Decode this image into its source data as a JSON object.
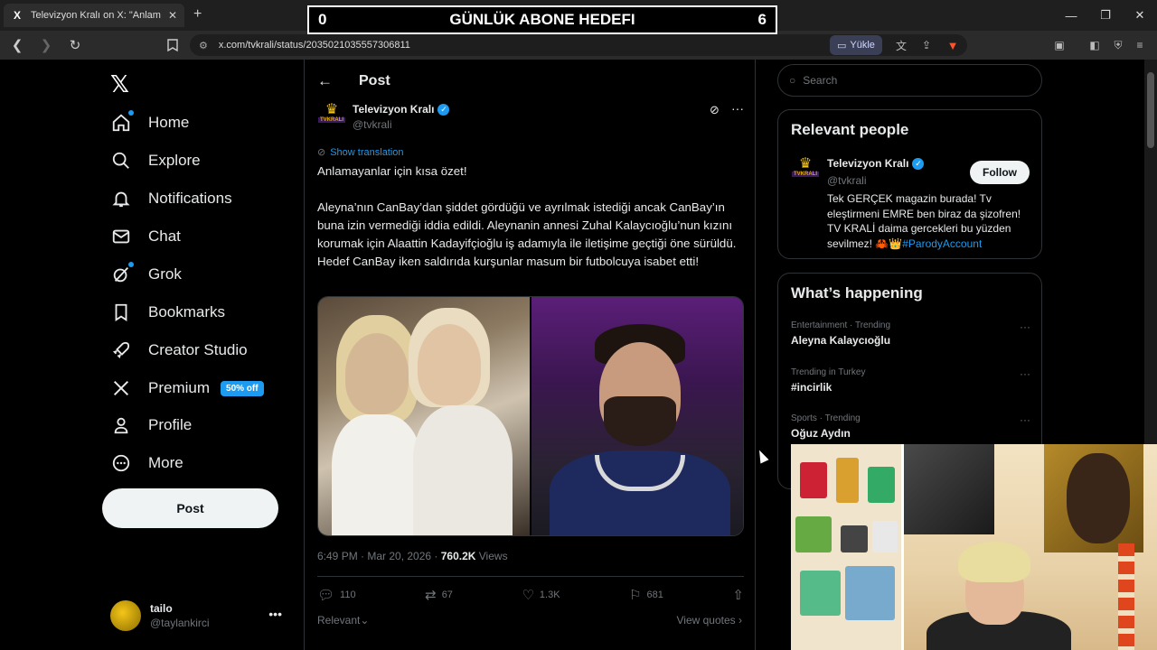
{
  "browser": {
    "tab_title": "Televizyon Kralı on X: \"Anlamaya",
    "tab_favicon": "X",
    "url": "x.com/tvkrali/status/2035021035557306811",
    "yukle_label": "Yükle"
  },
  "overlay_banner": {
    "left_count": "0",
    "title": "GÜNLÜK ABONE HEDEFI",
    "right_count": "6"
  },
  "nav": {
    "items": [
      {
        "label": "Home",
        "icon": "home-icon",
        "dot": true
      },
      {
        "label": "Explore",
        "icon": "search-icon",
        "dot": false
      },
      {
        "label": "Notifications",
        "icon": "bell-icon",
        "dot": false
      },
      {
        "label": "Chat",
        "icon": "mail-icon",
        "dot": false
      },
      {
        "label": "Grok",
        "icon": "grok-icon",
        "dot": true
      },
      {
        "label": "Bookmarks",
        "icon": "bookmark-icon",
        "dot": false
      },
      {
        "label": "Creator Studio",
        "icon": "rocket-icon",
        "dot": false
      },
      {
        "label": "Premium",
        "icon": "x-icon",
        "dot": false
      },
      {
        "label": "Profile",
        "icon": "person-icon",
        "dot": false
      },
      {
        "label": "More",
        "icon": "more-circle-icon",
        "dot": false
      }
    ],
    "premium_badge": "50% off",
    "post_button": "Post"
  },
  "account": {
    "name": "tailo",
    "handle": "@taylankirci"
  },
  "post": {
    "header_title": "Post",
    "author_name": "Televizyon Kralı",
    "author_handle": "@tvkrali",
    "avatar_text": "TVKRALI",
    "show_translation": "Show translation",
    "text_line1": "Anlamayanlar için kısa özet!",
    "text_body": "Aleyna’nın CanBay’dan şiddet gördüğü ve ayrılmak istediği ancak CanBay’ın buna izin vermediği iddia edildi. Aleynanin annesi Zuhal Kalaycıoğlu’nun kızını korumak için Alaattin Kadayifçioğlu iş adamıyla ile iletişime geçtiği öne sürüldü. Hedef CanBay iken saldırıda kurşunlar masum bir futbolcuya isabet etti!",
    "timestamp": "6:49 PM · Mar 20, 2026 · ",
    "views_count": "760.2K",
    "views_label": " Views",
    "replies": "110",
    "reposts": "67",
    "likes": "1.3K",
    "bookmarks": "681",
    "relevant_label": "Relevant",
    "view_quotes": "View quotes"
  },
  "search": {
    "placeholder": "Search"
  },
  "relevant_people": {
    "title": "Relevant people",
    "name": "Televizyon Kralı",
    "handle": "@tvkrali",
    "follow_label": "Follow",
    "bio": "Tek GERÇEK magazin burada! Tv eleştirmeni EMRE ben biraz da şizofren! TV KRALİ daima gercekleri bu yüzden sevilmez! 🦀👑",
    "bio_tag": "#ParodyAccount"
  },
  "whats_happening": {
    "title": "What’s happening",
    "trends": [
      {
        "category": "Entertainment · Trending",
        "name": "Aleyna Kalaycıoğlu"
      },
      {
        "category": "Trending in Turkey",
        "name": "#incirlik"
      },
      {
        "category": "Sports · Trending",
        "name": "Oğuz Aydın"
      }
    ]
  },
  "colors": {
    "accent": "#1d9bf0",
    "background": "#000000",
    "text": "#e7e9ea",
    "muted": "#71767b"
  }
}
